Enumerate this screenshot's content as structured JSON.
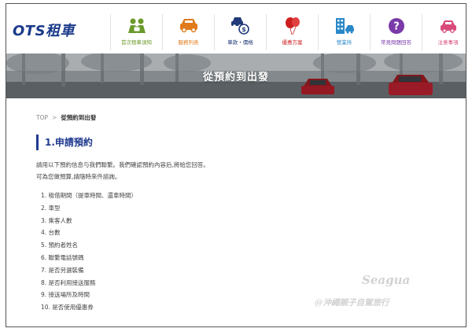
{
  "header": {
    "logo": "OTS租車",
    "nav": [
      {
        "label": "首次租車須知",
        "icon": "people-icon",
        "color": "#6a9a2a"
      },
      {
        "label": "服務列表",
        "icon": "car-icon",
        "color": "#e07a1a"
      },
      {
        "label": "車款・價格",
        "icon": "car-price-icon",
        "color": "#223a7a"
      },
      {
        "label": "優惠方案",
        "icon": "balloon-icon",
        "color": "#cc2020"
      },
      {
        "label": "營業所",
        "icon": "building-icon",
        "color": "#2a88c8"
      },
      {
        "label": "常見問題回答",
        "icon": "question-icon",
        "color": "#7a3aa8"
      },
      {
        "label": "注意事項",
        "icon": "car-note-icon",
        "color": "#d84a7a"
      }
    ]
  },
  "hero": {
    "title": "從預約到出發"
  },
  "breadcrumb": {
    "home": "TOP",
    "separator": ">",
    "current": "從預約到出發"
  },
  "section": {
    "title": "1.申請預約",
    "intro": [
      "請用以下預約信息与我們聯繫。我們確認預約內容后,將給您回答。",
      "可為您做預算,請隨時來件諮詢。"
    ],
    "steps": [
      "1. 租借期間（提車時間、還車時間）",
      "2. 車型",
      "3. 乘客人數",
      "4. 台數",
      "5. 預約者姓名",
      "6. 聯繫電話號碼",
      "7. 是否另選裝備",
      "8. 是否利用接送服務",
      "9. 接送場所及時間",
      "10. 是否使用優惠券"
    ]
  },
  "watermark": {
    "line1": "Seagua",
    "line2": "@沖繩親子自駕旅行"
  }
}
